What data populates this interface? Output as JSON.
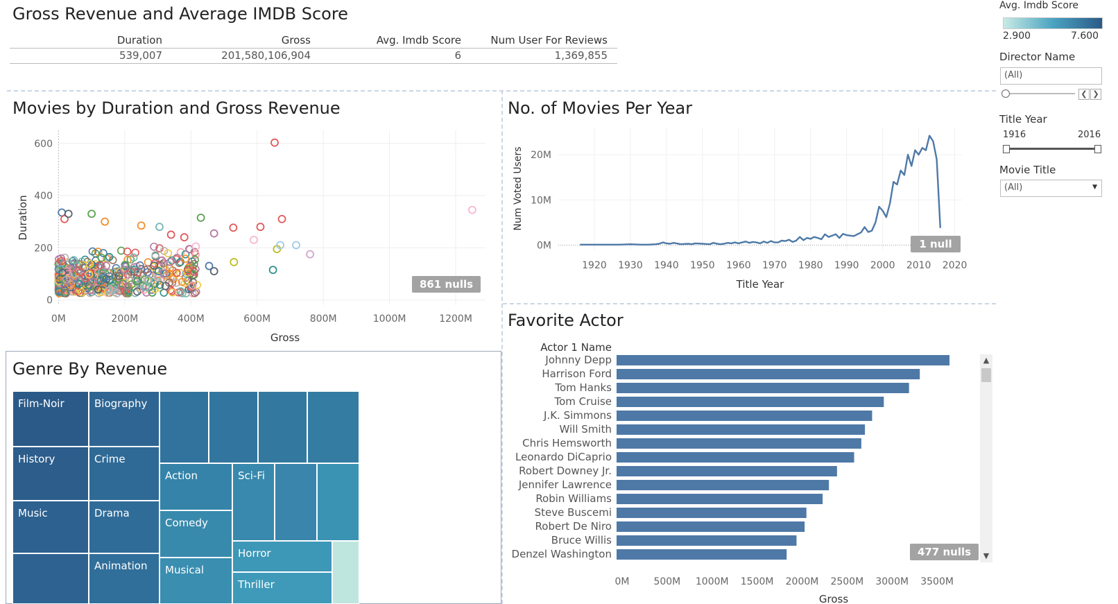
{
  "dashboard": {
    "title": "Gross Revenue and Average IMDB Score"
  },
  "summary": {
    "columns": [
      {
        "header": "Duration",
        "value": "539,007"
      },
      {
        "header": "Gross",
        "value": "201,580,106,904"
      },
      {
        "header": "Avg. Imdb Score",
        "value": "6"
      },
      {
        "header": "Num User For Reviews",
        "value": "1,369,855"
      }
    ]
  },
  "filters": {
    "color_legend_title": "Avg. Imdb Score",
    "color_min": "2.900",
    "color_max": "7.600",
    "director_label": "Director Name",
    "director_value": "(All)",
    "year_label": "Title Year",
    "year_min": "1916",
    "year_max": "2016",
    "movie_label": "Movie Title",
    "movie_value": "(All)",
    "prev_icon": "chevron-left-icon",
    "next_icon": "chevron-right-icon",
    "dropdown_icon": "chevron-down-icon"
  },
  "colors": {
    "bar": "#4e79a7",
    "line": "#4e79a7",
    "legend_low": "#c8ebe5",
    "legend_high": "#2b5a88",
    "null_badge": "#a3a3a3"
  },
  "chart_data": [
    {
      "type": "scatter",
      "title": "Movies by Duration and Gross Revenue",
      "xlabel": "Gross",
      "ylabel": "Duration",
      "xlim": [
        -5,
        1290
      ],
      "ylim": [
        -20,
        650
      ],
      "xticks": [
        "0M",
        "200M",
        "400M",
        "600M",
        "800M",
        "1000M",
        "1200M"
      ],
      "yticks": [
        "0",
        "200",
        "400",
        "600"
      ],
      "null_badge": "861 nulls",
      "points": [
        {
          "x": 653,
          "y": 603,
          "color": "#e15759"
        },
        {
          "x": 1250,
          "y": 345,
          "color": "#f7b6d2"
        },
        {
          "x": 675,
          "y": 310,
          "color": "#e15759"
        },
        {
          "x": 610,
          "y": 280,
          "color": "#e15759"
        },
        {
          "x": 528,
          "y": 277,
          "color": "#e15759"
        },
        {
          "x": 718,
          "y": 210,
          "color": "#9ecae9"
        },
        {
          "x": 760,
          "y": 175,
          "color": "#d4a6c8"
        },
        {
          "x": 660,
          "y": 195,
          "color": "#bcbd22"
        },
        {
          "x": 670,
          "y": 210,
          "color": "#9ecae9"
        },
        {
          "x": 648,
          "y": 115,
          "color": "#2f8f8a"
        },
        {
          "x": 530,
          "y": 145,
          "color": "#bcbd22"
        },
        {
          "x": 590,
          "y": 230,
          "color": "#f7b6d2"
        },
        {
          "x": 470,
          "y": 255,
          "color": "#b07aa1"
        },
        {
          "x": 430,
          "y": 315,
          "color": "#59a14f"
        },
        {
          "x": 405,
          "y": 55,
          "color": "#ff9da7"
        },
        {
          "x": 470,
          "y": 110,
          "color": "#59636e"
        },
        {
          "x": 455,
          "y": 130,
          "color": "#4e79a7"
        },
        {
          "x": 100,
          "y": 330,
          "color": "#59a14f"
        },
        {
          "x": 140,
          "y": 300,
          "color": "#f28e2b"
        },
        {
          "x": 250,
          "y": 285,
          "color": "#f28e2b"
        },
        {
          "x": 305,
          "y": 280,
          "color": "#76b7b2"
        },
        {
          "x": 340,
          "y": 250,
          "color": "#e15759"
        },
        {
          "x": 380,
          "y": 240,
          "color": "#e15759"
        },
        {
          "x": 395,
          "y": 195,
          "color": "#b07aa1"
        },
        {
          "x": 415,
          "y": 205,
          "color": "#f7b6d2"
        },
        {
          "x": 10,
          "y": 335,
          "color": "#4e79a7"
        },
        {
          "x": 18,
          "y": 310,
          "color": "#e15759"
        },
        {
          "x": 30,
          "y": 330,
          "color": "#59636e"
        }
      ]
    },
    {
      "type": "line",
      "title": "No. of Movies Per Year",
      "xlabel": "Title Year",
      "ylabel": "Num Voted Users",
      "xlim": [
        1910,
        2022
      ],
      "ylim": [
        -1,
        26
      ],
      "y_unit": "M",
      "xticks": [
        1920,
        1930,
        1940,
        1950,
        1960,
        1970,
        1980,
        1990,
        2000,
        2010,
        2020
      ],
      "yticks": [
        "0M",
        "10M",
        "20M"
      ],
      "null_badge": "1 null",
      "x": [
        1916,
        1920,
        1925,
        1927,
        1930,
        1933,
        1935,
        1937,
        1938,
        1939,
        1940,
        1941,
        1942,
        1944,
        1946,
        1947,
        1948,
        1950,
        1952,
        1953,
        1954,
        1955,
        1956,
        1957,
        1958,
        1959,
        1960,
        1961,
        1962,
        1963,
        1964,
        1965,
        1966,
        1967,
        1968,
        1969,
        1970,
        1971,
        1972,
        1973,
        1974,
        1975,
        1976,
        1977,
        1978,
        1979,
        1980,
        1981,
        1982,
        1983,
        1984,
        1985,
        1986,
        1987,
        1988,
        1989,
        1990,
        1991,
        1992,
        1993,
        1994,
        1995,
        1996,
        1997,
        1998,
        1999,
        2000,
        2001,
        2002,
        2003,
        2004,
        2005,
        2006,
        2007,
        2008,
        2009,
        2010,
        2011,
        2012,
        2013,
        2014,
        2015,
        2016
      ],
      "y": [
        0.1,
        0.1,
        0.1,
        0.1,
        0.2,
        0.1,
        0.1,
        0.2,
        0.3,
        0.6,
        0.4,
        0.3,
        0.5,
        0.2,
        0.3,
        0.2,
        0.4,
        0.3,
        0.2,
        0.5,
        0.3,
        0.2,
        0.3,
        0.5,
        0.4,
        0.6,
        0.4,
        0.6,
        0.8,
        0.5,
        0.7,
        0.6,
        0.4,
        0.8,
        0.5,
        0.9,
        0.6,
        0.6,
        1.0,
        0.9,
        1.2,
        0.7,
        1.0,
        1.8,
        1.1,
        1.6,
        1.4,
        1.8,
        1.6,
        1.3,
        2.4,
        1.8,
        2.1,
        2.4,
        1.6,
        2.5,
        2.2,
        2.1,
        2.0,
        2.4,
        2.8,
        4.0,
        2.9,
        3.2,
        5.0,
        8.5,
        7.6,
        6.2,
        9.2,
        14.0,
        13.4,
        16.5,
        15.5,
        20.0,
        17.5,
        21.0,
        20.0,
        21.5,
        21.0,
        24.2,
        23.0,
        19.0,
        3.8
      ]
    },
    {
      "type": "bar",
      "orientation": "horizontal",
      "title": "Favorite Actor",
      "category_header": "Actor 1 Name",
      "xlabel": "Gross",
      "xlim": [
        0,
        3900
      ],
      "xticks": [
        "0M",
        "500M",
        "1000M",
        "1500M",
        "2000M",
        "2500M",
        "3000M",
        "3500M"
      ],
      "null_badge": "477 nulls",
      "categories": [
        "Johnny Depp",
        "Harrison Ford",
        "Tom Hanks",
        "Tom Cruise",
        "J.K. Simmons",
        "Will Smith",
        "Chris Hemsworth",
        "Leonardo DiCaprio",
        "Robert Downey Jr.",
        "Jennifer Lawrence",
        "Robin Williams",
        "Steve Buscemi",
        "Robert De Niro",
        "Bruce Willis",
        "Denzel Washington"
      ],
      "values": [
        3700,
        3370,
        3250,
        2970,
        2840,
        2760,
        2720,
        2640,
        2450,
        2360,
        2290,
        2110,
        2090,
        2000,
        1890
      ]
    },
    {
      "type": "treemap",
      "title": "Genre By Revenue",
      "cells": [
        {
          "label": "Film-Noir",
          "color": "#2b5a88"
        },
        {
          "label": "Biography",
          "color": "#2f6592"
        },
        {
          "label": "History",
          "color": "#2c5d8b"
        },
        {
          "label": "Crime",
          "color": "#2f6a96"
        },
        {
          "label": "Music",
          "color": "#2d618f"
        },
        {
          "label": "Drama",
          "color": "#306c98"
        },
        {
          "label": "",
          "color": "#2e6391"
        },
        {
          "label": "Animation",
          "color": "#316f9b"
        },
        {
          "label": "",
          "color": "#31739d"
        },
        {
          "label": "",
          "color": "#32769f"
        },
        {
          "label": "",
          "color": "#33799f"
        },
        {
          "label": "",
          "color": "#347ca2"
        },
        {
          "label": "Action",
          "color": "#3583a8"
        },
        {
          "label": "Sci-Fi",
          "color": "#3889ad"
        },
        {
          "label": "",
          "color": "#3985ab"
        },
        {
          "label": "",
          "color": "#3b93b3"
        },
        {
          "label": "Comedy",
          "color": "#388aac"
        },
        {
          "label": "Horror",
          "color": "#3d97b7"
        },
        {
          "label": "Musical",
          "color": "#3a8eb0"
        },
        {
          "label": "Thriller",
          "color": "#3f9ab9"
        },
        {
          "label": "",
          "color": "#bfe6de"
        }
      ]
    }
  ]
}
